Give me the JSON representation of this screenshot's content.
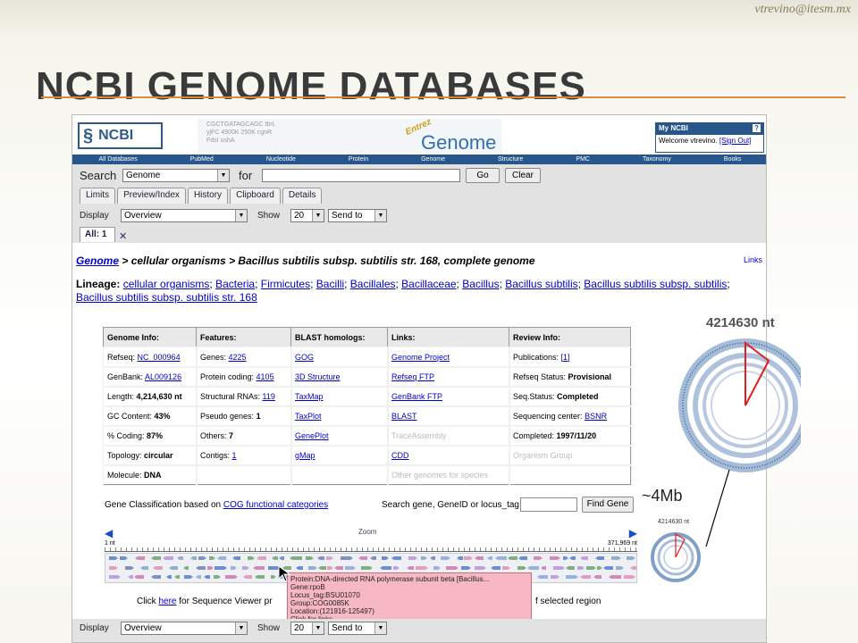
{
  "slide": {
    "credit": "vtrevino@itesm.mx",
    "title": "NCBI GENOME DATABASES",
    "annotation_mb": "~4Mb",
    "genome_big_label": "4214630 nt",
    "genome_small_label": "4214630 nt"
  },
  "header": {
    "logo_text": "NCBI",
    "entrez_text": "Entrez",
    "genome_text": "Genome",
    "banner_genes": [
      "CGCTGATAGCAGC",
      "tbrL",
      "yjFC",
      "4900K",
      "250K",
      "cgnR",
      "FdsI",
      "ushA"
    ],
    "myncbi_title": "My NCBI",
    "myncbi_help": "?",
    "welcome": "Welcome vtrevino.",
    "signout": "[Sign Out]"
  },
  "topnav": [
    "All Databases",
    "PubMed",
    "Nucleotide",
    "Protein",
    "Genome",
    "Structure",
    "PMC",
    "Taxonomy",
    "Books"
  ],
  "search": {
    "label": "Search",
    "db_value": "Genome",
    "for_label": "for",
    "go": "Go",
    "clear": "Clear",
    "tabs": [
      "Limits",
      "Preview/Index",
      "History",
      "Clipboard",
      "Details"
    ]
  },
  "display": {
    "label": "Display",
    "value": "Overview",
    "show_label": "Show",
    "show_value": "20",
    "sendto": "Send to",
    "all_tab": "All: 1"
  },
  "breadcrumb": {
    "link": "Genome",
    "rest": " > cellular organisms > Bacillus subtilis subsp. subtilis str. 168, complete genome",
    "links_right": "Links"
  },
  "lineage": {
    "label": "Lineage:",
    "items": [
      "cellular organisms",
      "Bacteria",
      "Firmicutes",
      "Bacilli",
      "Bacillales",
      "Bacillaceae",
      "Bacillus",
      "Bacillus subtilis",
      "Bacillus subtilis subsp. subtilis",
      "Bacillus subtilis subsp. subtilis str. 168"
    ]
  },
  "table": {
    "headers": [
      "Genome Info:",
      "Features:",
      "BLAST homologs:",
      "Links:",
      "Review Info:"
    ],
    "rows": [
      [
        {
          "t": "Refseq: "
        },
        {
          "l": "NC_000964"
        },
        {
          "t": "Genes: "
        },
        {
          "l": "4225"
        },
        {
          "l": "GOG"
        },
        {
          "l": "Genome Project"
        },
        {
          "t": "Publications: "
        },
        {
          "l": "[1]"
        }
      ],
      [
        {
          "t": "GenBank: "
        },
        {
          "l": "AL009126"
        },
        {
          "t": "Protein coding: "
        },
        {
          "l": "4105"
        },
        {
          "l": "3D Structure"
        },
        {
          "l": "Refseq FTP"
        },
        {
          "t": "Refseq Status: "
        },
        {
          "b": "Provisional"
        }
      ]
    ],
    "c": {
      "r1": [
        "Refseq: ",
        "NC_000964",
        "Genes: ",
        "4225",
        "GOG",
        "Genome Project",
        "Publications: ",
        "[1]"
      ],
      "r2": [
        "GenBank: ",
        "AL009126",
        "Protein coding: ",
        "4105",
        "3D Structure",
        "Refseq FTP",
        "Refseq Status: ",
        "Provisional"
      ],
      "r3": [
        "Length: ",
        "4,214,630 nt",
        "Structural RNAs: ",
        "119",
        "TaxMap",
        "GenBank FTP",
        "Seq.Status: ",
        "Completed"
      ],
      "r4": [
        "GC Content: ",
        "43%",
        "Pseudo genes: ",
        "1",
        "TaxPlot",
        "BLAST",
        "Sequencing center: ",
        "BSNR"
      ],
      "r5": [
        "% Coding: ",
        "87%",
        "Others: ",
        "7",
        "GenePlot",
        "TraceAssembly",
        "Completed: ",
        "1997/11/20"
      ],
      "r6": [
        "Topology: ",
        "circular",
        "Contigs: ",
        "1",
        "gMap",
        "CDD",
        "Organism Group"
      ],
      "r7": [
        "Molecule: ",
        "DNA",
        "Other genomes for species"
      ]
    }
  },
  "geneclass": {
    "text": "Gene Classification based on ",
    "link": "COG functional categories",
    "search_label": "Search gene, GeneID or locus_tag:",
    "find_button": "Find Gene"
  },
  "viewer": {
    "zoom": "Zoom",
    "start": "1 nt",
    "end": "371,969 nt"
  },
  "tooltip": {
    "lines": [
      "Protein:DNA-directed RNA polymerase subunit beta [Bacillus...",
      "Gene:rpoB",
      "Locus_tag:BSU01070",
      "Group:COG0085K",
      "Location:(121916-125497)",
      "Click for links"
    ]
  },
  "click_row": {
    "prefix": "Click ",
    "link": "here",
    "suffix": " for Sequence Viewer pr",
    "right": "f selected region"
  },
  "colors": {
    "ncbi_blue": "#27568c",
    "title_rule": "#d88a3a",
    "tooltip_bg": "#f7b8c4",
    "link": "#0000cc"
  }
}
